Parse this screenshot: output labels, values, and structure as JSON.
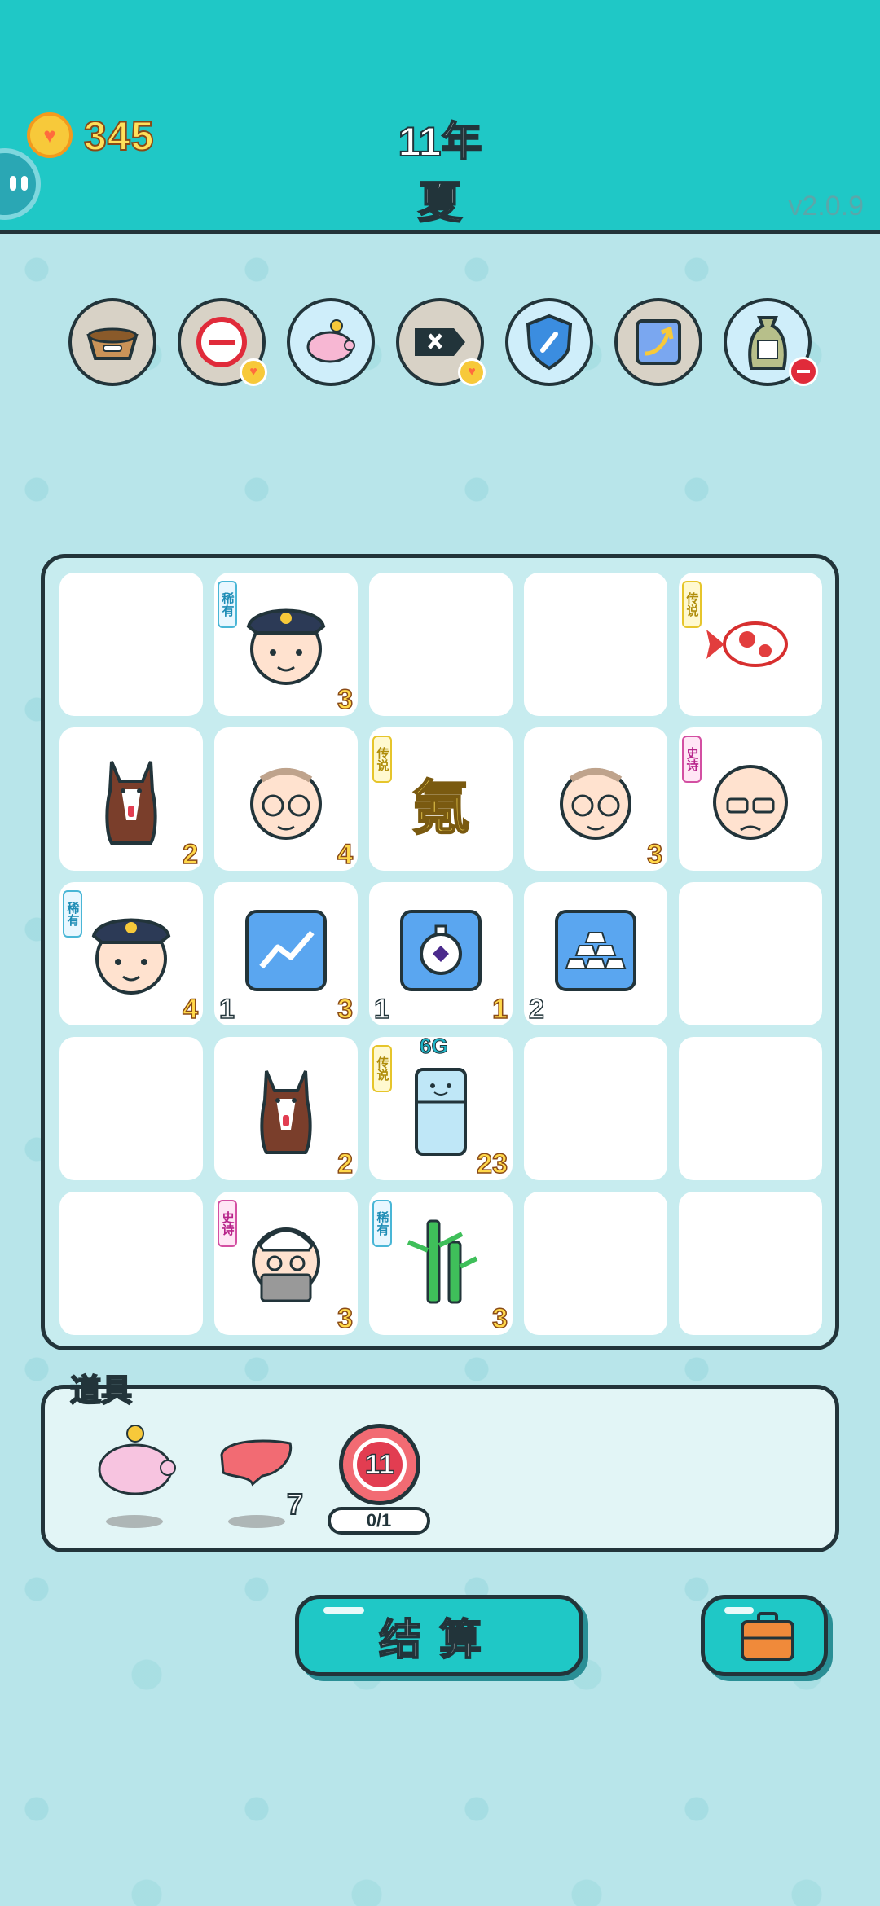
{
  "header": {
    "coins": "345",
    "year": "11年",
    "season": "夏",
    "version": "v2.0.9"
  },
  "relics": [
    {
      "name": "pet-food-bowl-icon"
    },
    {
      "name": "remove-circle-icon"
    },
    {
      "name": "piggy-bank-icon"
    },
    {
      "name": "delete-tag-icon"
    },
    {
      "name": "shield-wrench-icon"
    },
    {
      "name": "upgrade-arrow-card-icon"
    },
    {
      "name": "money-bag-icon"
    }
  ],
  "board": {
    "rows": [
      [
        {
          "icon": ""
        },
        {
          "icon": "police-officer-icon",
          "rarity": "稀有",
          "count": "3"
        },
        {
          "icon": ""
        },
        {
          "icon": ""
        },
        {
          "icon": "koi-fish-icon",
          "rarity": "传说"
        }
      ],
      [
        {
          "icon": "husky-dog-icon",
          "count": "2"
        },
        {
          "icon": "old-man-glasses-icon",
          "count": "4"
        },
        {
          "icon": "krypton-character",
          "rarity": "传说",
          "text": "氪"
        },
        {
          "icon": "old-man-glasses-icon",
          "count": "3"
        },
        {
          "icon": "bald-old-man-icon",
          "rarity": "史诗"
        }
      ],
      [
        {
          "icon": "police-officer-icon",
          "rarity": "稀有",
          "count": "4"
        },
        {
          "icon": "trend-chart-card-icon",
          "lcount": "1",
          "count": "3"
        },
        {
          "icon": "stopwatch-card-icon",
          "lcount": "1",
          "count": "1"
        },
        {
          "icon": "gold-bars-card-icon",
          "lcount": "2"
        },
        {
          "icon": ""
        }
      ],
      [
        {
          "icon": ""
        },
        {
          "icon": "husky-dog-icon",
          "count": "2"
        },
        {
          "icon": "refrigerator-icon",
          "rarity": "传说",
          "tag": "6G",
          "count": "23"
        },
        {
          "icon": ""
        },
        {
          "icon": ""
        }
      ],
      [
        {
          "icon": ""
        },
        {
          "icon": "bearded-old-man-icon",
          "rarity": "史诗",
          "count": "3"
        },
        {
          "icon": "bamboo-icon",
          "rarity": "稀有",
          "count": "3"
        },
        {
          "icon": ""
        },
        {
          "icon": ""
        }
      ]
    ]
  },
  "items": {
    "title": "道具",
    "list": [
      {
        "icon": "piggy-bank-icon"
      },
      {
        "icon": "liver-icon",
        "count": "7"
      },
      {
        "icon": "target-badge-icon",
        "badge": "11",
        "progress": "0/1"
      }
    ]
  },
  "buttons": {
    "settle": "结算",
    "bag": "briefcase-icon"
  },
  "colors": {
    "header": "#1fc8c6",
    "background": "#b9e6ec",
    "outline": "#22343a",
    "coin": "#f7c93a"
  }
}
